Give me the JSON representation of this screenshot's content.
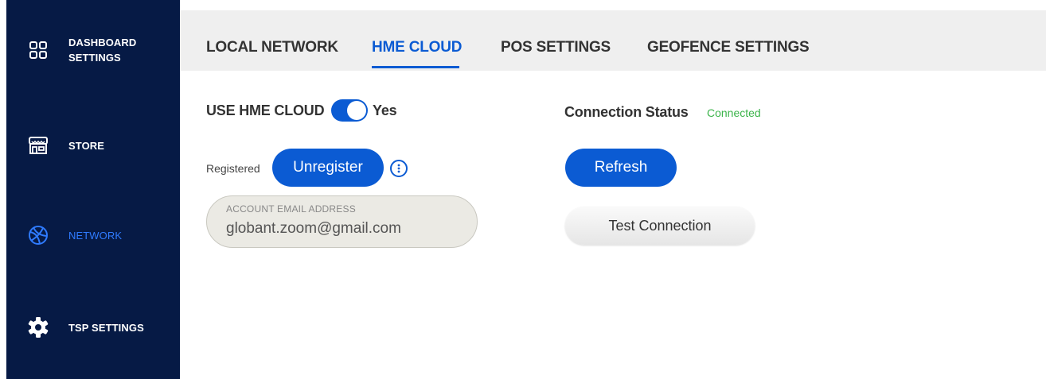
{
  "sidebar": {
    "items": [
      {
        "label_line1": "DASHBOARD",
        "label_line2": "SETTINGS",
        "icon": "grid-icon"
      },
      {
        "label": "STORE",
        "icon": "store-icon"
      },
      {
        "label": "NETWORK",
        "icon": "network-icon",
        "active": true
      },
      {
        "label": "TSP SETTINGS",
        "icon": "gear-icon"
      }
    ]
  },
  "tabs": [
    {
      "label": "LOCAL NETWORK"
    },
    {
      "label": "HME CLOUD",
      "active": true
    },
    {
      "label": "POS SETTINGS"
    },
    {
      "label": "GEOFENCE SETTINGS"
    }
  ],
  "cloud": {
    "use_label": "USE HME CLOUD",
    "toggle_state": "Yes",
    "registered_label": "Registered",
    "unregister_label": "Unregister",
    "email_caption": "ACCOUNT EMAIL ADDRESS",
    "email_value": "globant.zoom@gmail.com"
  },
  "connection": {
    "status_label": "Connection Status",
    "status_value": "Connected",
    "refresh_label": "Refresh",
    "test_label": "Test Connection"
  },
  "colors": {
    "sidebar_bg": "#061a45",
    "accent": "#0b5bd3",
    "active_nav": "#2f7bff",
    "status_ok": "#3cb44b"
  }
}
